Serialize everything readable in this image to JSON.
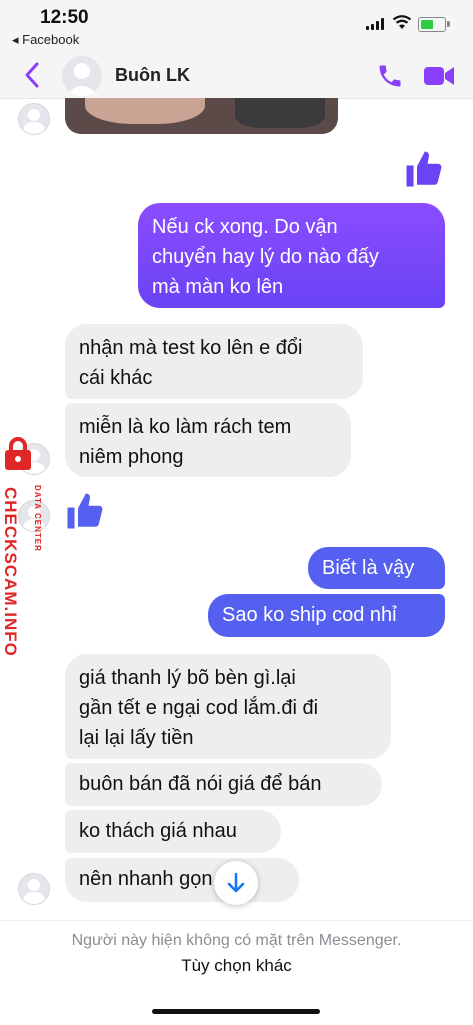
{
  "status_bar": {
    "time": "12:50",
    "back_app": "◂ Facebook"
  },
  "header": {
    "contact_name": "Buôn LK"
  },
  "messages": [
    {
      "from": "me",
      "type": "like"
    },
    {
      "from": "me",
      "text": "Nếu ck xong. Do vận\nchuyển hay lý do nào đấy\nmà màn ko lên"
    },
    {
      "from": "them",
      "text": "nhận mà test ko lên e đổi\ncái khác"
    },
    {
      "from": "them",
      "text": "miễn là ko làm rách tem\nniêm phong"
    },
    {
      "from": "them",
      "type": "like"
    },
    {
      "from": "me",
      "text": "Biết là vậy"
    },
    {
      "from": "me",
      "text": "Sao ko ship cod nhỉ"
    },
    {
      "from": "them",
      "text": "giá thanh lý bõ bèn gì.lại\ngần tết e ngại cod lắm.đi  đi\nlại lại lấy tiền"
    },
    {
      "from": "them",
      "text": "buôn bán đã nói giá để bán"
    },
    {
      "from": "them",
      "text": "ko thách giá nhau"
    },
    {
      "from": "them",
      "text": "nên nhanh gọn thôi"
    }
  ],
  "watermark": {
    "brand": "CHECKSCAM.INFO",
    "subtitle": "DATA CENTER"
  },
  "footer": {
    "presence_note": "Người này hiện không có mặt trên Messenger.",
    "more_options": "Tùy chọn khác"
  },
  "colors": {
    "accent": "#7b4dff",
    "outgoing_bubble_top": "#8a4dff",
    "outgoing_bubble_blue": "#5660f0",
    "incoming_bubble": "#eeeeee",
    "watermark_red": "#e02626"
  }
}
